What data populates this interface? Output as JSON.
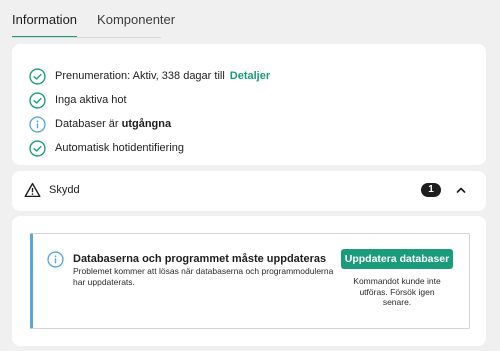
{
  "tabs": [
    {
      "label": "Information",
      "active": true
    },
    {
      "label": "Komponenter",
      "active": false
    }
  ],
  "status": {
    "items": [
      {
        "icon": "check-circle-icon",
        "text": "Prenumeration: Aktiv, 338 dagar till",
        "link": "Detaljer"
      },
      {
        "icon": "check-circle-icon",
        "text": "Inga aktiva hot"
      },
      {
        "icon": "info-circle-icon",
        "text": "Databaser är",
        "strong": "utgångna"
      },
      {
        "icon": "check-circle-icon",
        "text": "Automatisk hotidentifiering"
      }
    ]
  },
  "protection": {
    "icon": "warning-triangle-icon",
    "label": "Skydd",
    "badge": "1",
    "chevron": "chevron-up-icon"
  },
  "update_notice": {
    "icon": "info-circle-icon",
    "title": "Databaserna och programmet måste uppdateras",
    "text": "Problemet kommer att lösas när databaserna och programmodulerna har uppdaterats.",
    "button_label": "Uppdatera databaser",
    "button_note": "Kommandot kunde inte utföras. Försök igen senare."
  },
  "colors": {
    "accent": "#1a9b7b",
    "info": "#5aa7d9",
    "badge_bg": "#1d1d1b",
    "background": "#f0f0f0"
  }
}
